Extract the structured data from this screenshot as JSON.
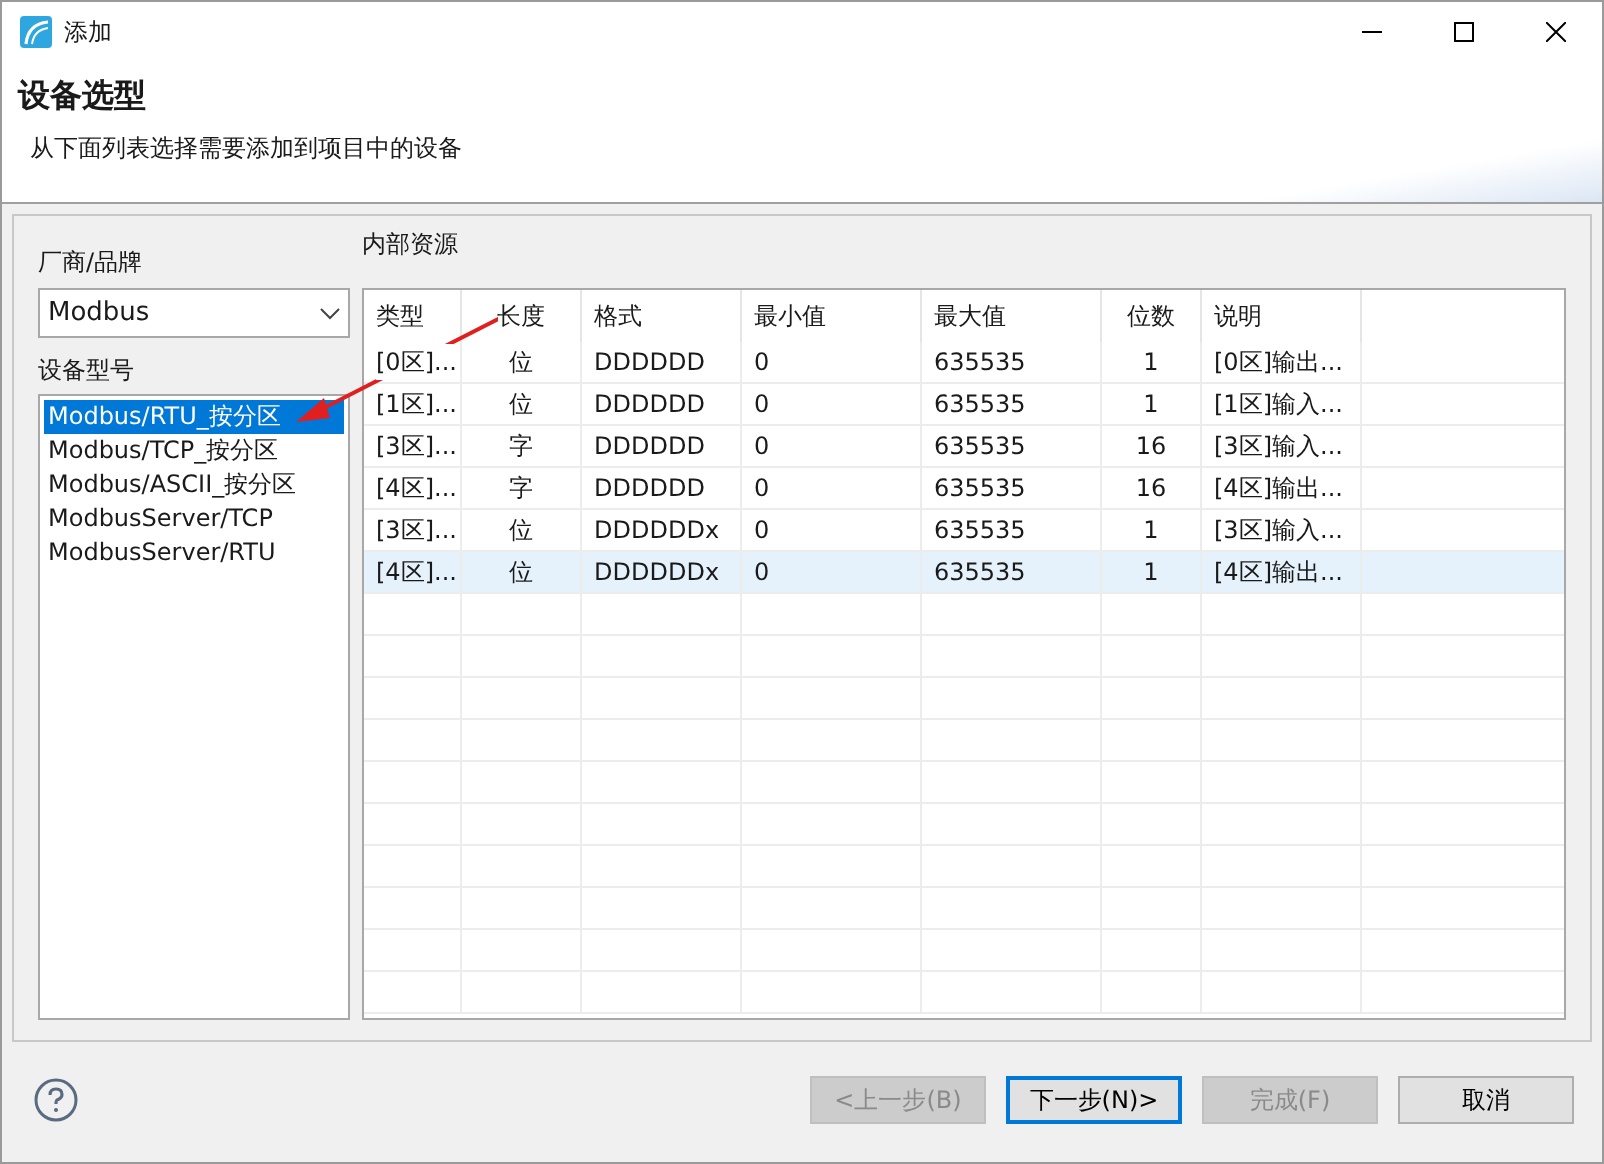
{
  "window": {
    "title": "添加"
  },
  "header": {
    "title": "设备选型",
    "subtitle": "从下面列表选择需要添加到项目中的设备"
  },
  "vendor": {
    "label": "厂商/品牌",
    "value": "Modbus"
  },
  "models": {
    "label": "设备型号",
    "items": [
      {
        "label": "Modbus/RTU_按分区",
        "selected": true
      },
      {
        "label": "Modbus/TCP_按分区",
        "selected": false
      },
      {
        "label": "Modbus/ASCII_按分区",
        "selected": false
      },
      {
        "label": "ModbusServer/TCP",
        "selected": false
      },
      {
        "label": "ModbusServer/RTU",
        "selected": false
      }
    ]
  },
  "resources": {
    "label": "内部资源",
    "columns": [
      "类型",
      "长度",
      "格式",
      "最小值",
      "最大值",
      "位数",
      "说明"
    ],
    "rows": [
      {
        "cells": [
          "[0区]...",
          "位",
          "DDDDDD",
          "0",
          "635535",
          "1",
          "[0区]输出..."
        ],
        "selected": false
      },
      {
        "cells": [
          "[1区]...",
          "位",
          "DDDDDD",
          "0",
          "635535",
          "1",
          "[1区]输入..."
        ],
        "selected": false
      },
      {
        "cells": [
          "[3区]...",
          "字",
          "DDDDDD",
          "0",
          "635535",
          "16",
          "[3区]输入..."
        ],
        "selected": false
      },
      {
        "cells": [
          "[4区]...",
          "字",
          "DDDDDD",
          "0",
          "635535",
          "16",
          "[4区]输出..."
        ],
        "selected": false
      },
      {
        "cells": [
          "[3区]...",
          "位",
          "DDDDDDx",
          "0",
          "635535",
          "1",
          "[3区]输入..."
        ],
        "selected": false
      },
      {
        "cells": [
          "[4区]...",
          "位",
          "DDDDDDx",
          "0",
          "635535",
          "1",
          "[4区]输出..."
        ],
        "selected": true
      }
    ]
  },
  "buttons": [
    {
      "label": "<上一步(B)",
      "disabled": true,
      "default": false
    },
    {
      "label": "下一步(N)>",
      "disabled": false,
      "default": true
    },
    {
      "label": "完成(F)",
      "disabled": true,
      "default": false
    },
    {
      "label": "取消",
      "disabled": false,
      "default": false
    }
  ]
}
